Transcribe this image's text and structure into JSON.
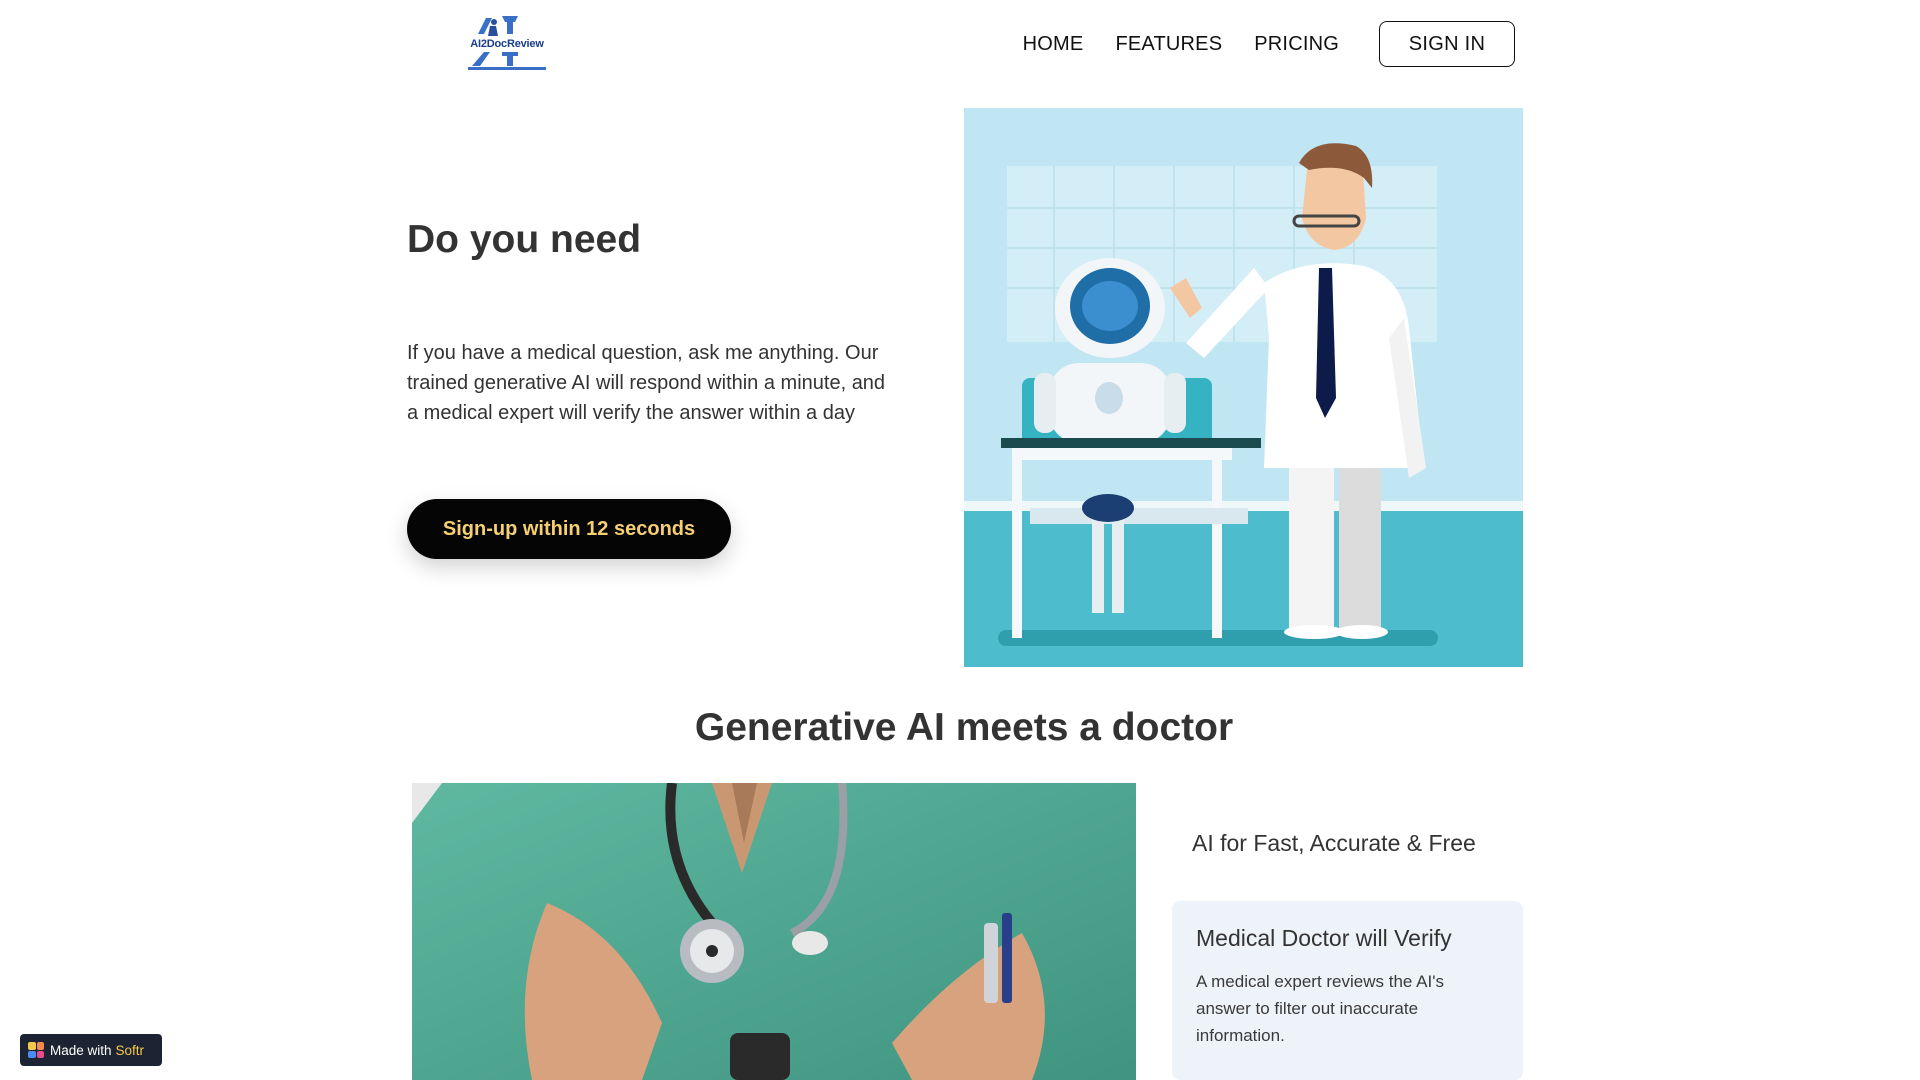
{
  "header": {
    "logo_text": "AI2DocReview",
    "nav": [
      "HOME",
      "FEATURES",
      "PRICING"
    ],
    "signin_label": "SIGN IN"
  },
  "hero": {
    "title": "Do you need",
    "description": "If you have a medical question, ask me anything. Our trained generative AI will respond within a minute, and a medical expert will verify the answer within a day",
    "cta_label": "Sign-up within 12 seconds"
  },
  "section": {
    "title": "Generative AI meets a doctor",
    "feature_heading": "AI for Fast, Accurate & Free",
    "card": {
      "title": "Medical Doctor will Verify",
      "description": "A medical expert reviews the AI's answer to filter out inaccurate information."
    }
  },
  "badge": {
    "prefix": "Made with",
    "brand": "Softr"
  },
  "colors": {
    "cta_bg": "#050505",
    "cta_text": "#f5cf72",
    "card_bg": "#eef3fa",
    "hero_sky": "#bfe6f2",
    "hero_floor": "#4dbccc",
    "scrubs": "#5fb8a0"
  }
}
